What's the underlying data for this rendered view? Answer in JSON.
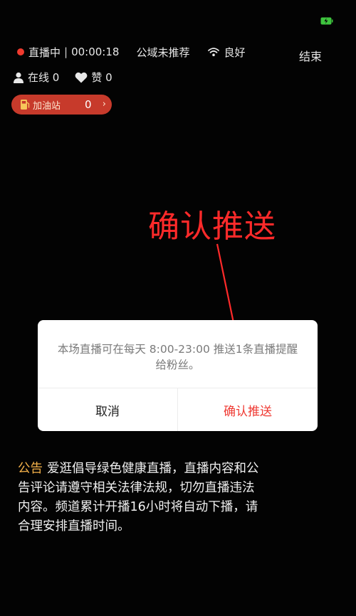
{
  "status_bar": {
    "battery_icon": "battery-charging-icon",
    "battery_color": "#3ec43e"
  },
  "live_status": {
    "state": "直播中",
    "separator": "|",
    "duration": "00:00:18",
    "recommend": "公域未推荐",
    "signal_icon": "wifi-icon",
    "signal": "良好",
    "dot_color": "#f03a2e"
  },
  "end_label": "结束",
  "stats": {
    "online_label": "在线",
    "online_count": "0",
    "likes_label": "赞",
    "likes_count": "0"
  },
  "fuel_station": {
    "label": "加油站",
    "count": "0",
    "chevron": "›",
    "color": "#c73a2b"
  },
  "annotation": {
    "text": "确认推送",
    "color": "#ff2a2a"
  },
  "dialog": {
    "message": "本场直播可在每天 8:00-23:00 推送1条直播提醒给粉丝。",
    "cancel_label": "取消",
    "confirm_label": "确认推送",
    "confirm_color": "#ef3a33"
  },
  "notice": {
    "tag": "公告",
    "text": "爱逛倡导绿色健康直播，直播内容和公告评论请遵守相关法律法规，切勿直播违法内容。频道累计开播16小时将自动下播，请合理安排直播时间。"
  }
}
